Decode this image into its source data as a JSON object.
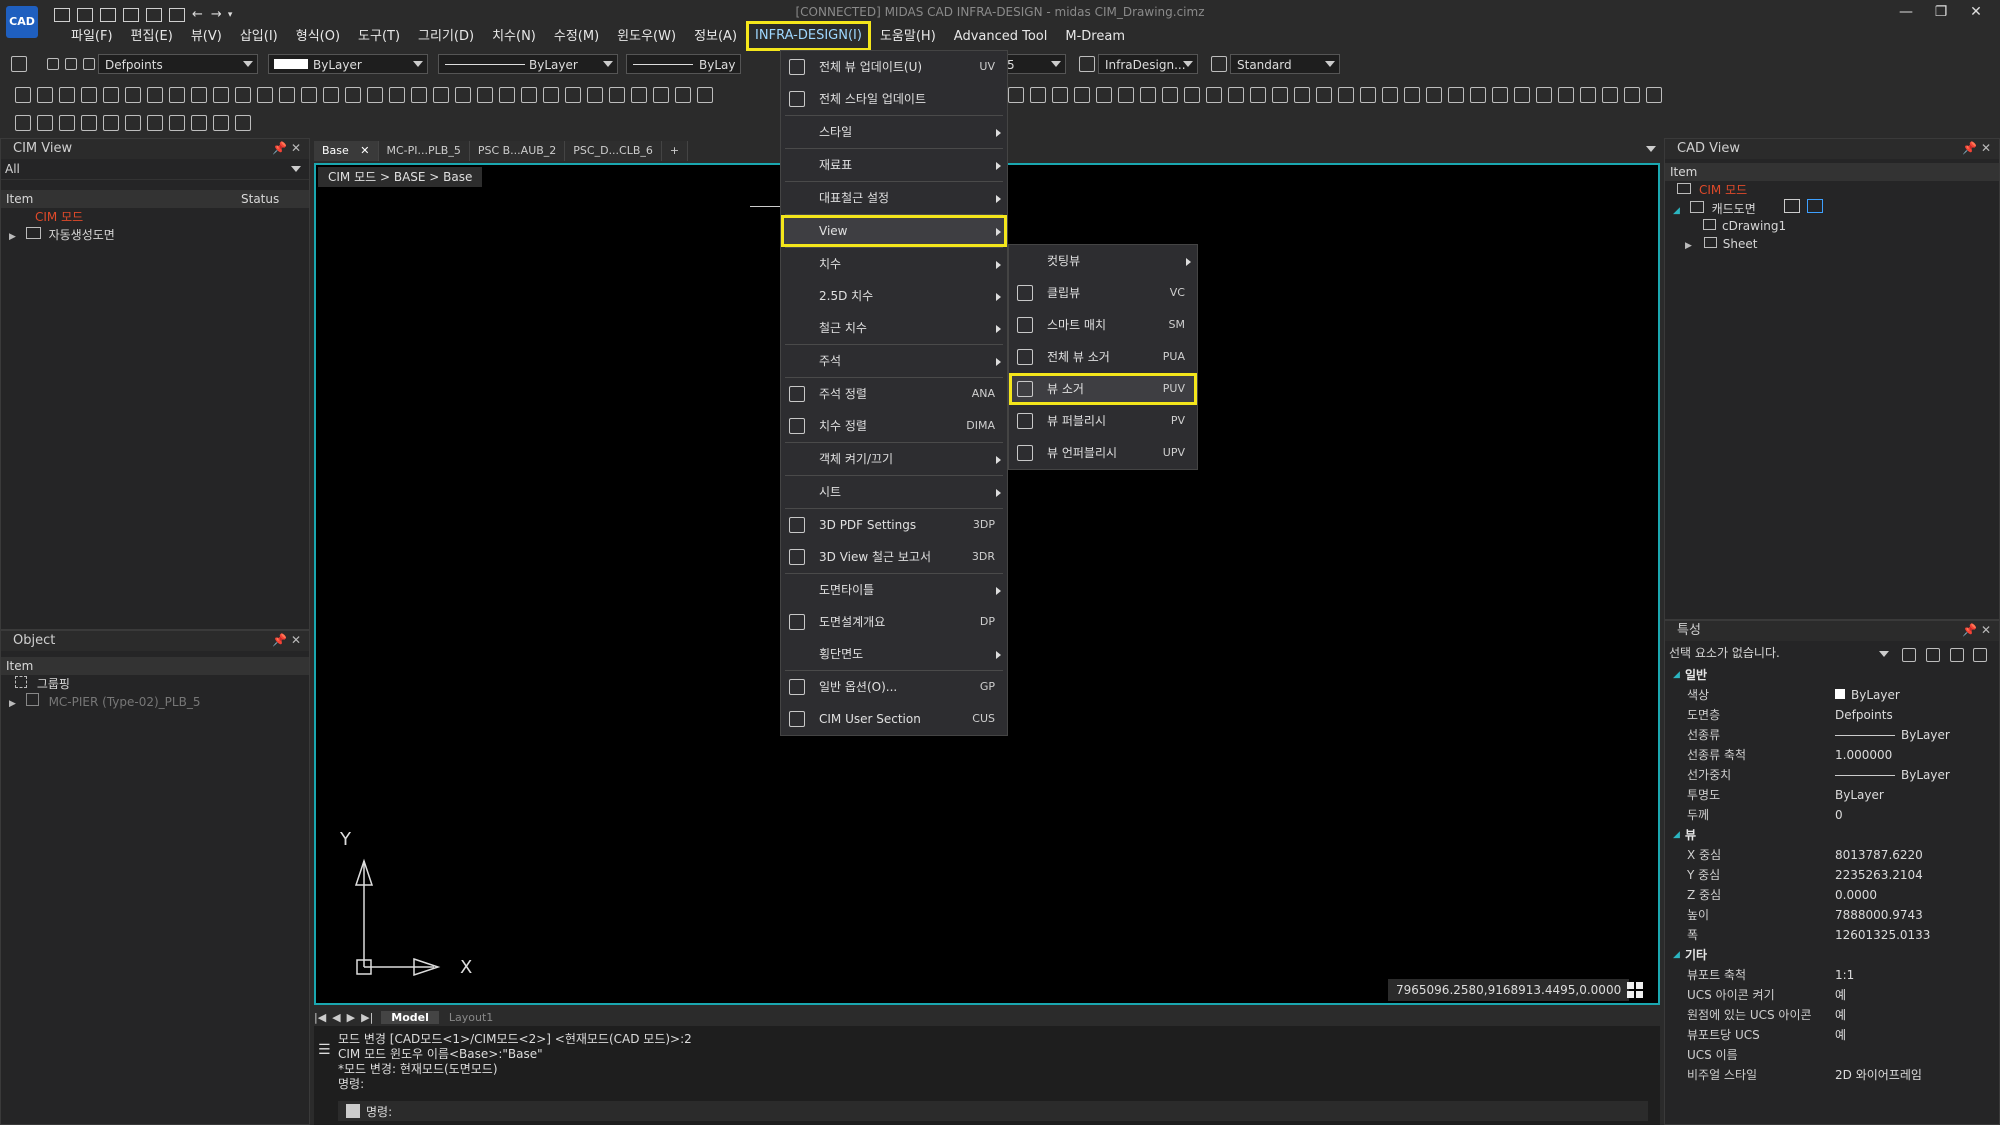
{
  "window": {
    "title": "[CONNECTED] MIDAS CAD INFRA-DESIGN - midas CIM_Drawing.cimz",
    "logo": "CAD",
    "controls": [
      "—",
      "❐",
      "✕"
    ]
  },
  "menubar": [
    "파일(F)",
    "편집(E)",
    "뷰(V)",
    "삽입(I)",
    "형식(O)",
    "도구(T)",
    "그리기(D)",
    "치수(N)",
    "수정(M)",
    "윈도우(W)",
    "정보(A)",
    "INFRA-DESIGN(I)",
    "도움말(H)",
    "Advanced Tool",
    "M-Dream"
  ],
  "toolbar": {
    "layer": "Defpoints",
    "color": "ByLayer",
    "linetype": "ByLayer",
    "lineweight": "ByLay",
    "dimstyle": "InfraDesign...",
    "textstyle": "Standard",
    "num": "5"
  },
  "cim_view": {
    "title": "CIM View",
    "filter": "All",
    "col_item": "Item",
    "col_status": "Status",
    "root": "CIM 모드",
    "child": "자동생성도면"
  },
  "object_panel": {
    "title": "Object",
    "col_item": "Item",
    "row1": "그룹핑",
    "row2": "MC-PIER (Type-02)_PLB_5"
  },
  "doc_tabs": [
    "Base",
    "MC-PI...PLB_5",
    "PSC B...AUB_2",
    "PSC_D...CLB_6",
    "+"
  ],
  "breadcrumb": "CIM 모드 > BASE > Base",
  "canvas": {
    "axis_y": "Y",
    "axis_x": "X",
    "coords": "7965096.2580,9168913.4495,0.0000"
  },
  "layout_tabs": [
    "Model",
    "Layout1"
  ],
  "command": {
    "lines": [
      "모드 변경 [CAD모드<1>/CIM모드<2>] <현재모드(CAD 모드)>:2",
      "CIM 모드 윈도우 이름<Base>:\"Base\"",
      "*모드 변경: 현재모드(도면모드)",
      "명령:"
    ],
    "prompt": "명령:"
  },
  "infra_menu": [
    {
      "label": "전체 뷰 업데이트(U)",
      "shortcut": "UV",
      "icon": "update-view-icon"
    },
    {
      "label": "전체 스타일 업데이트",
      "shortcut": "",
      "icon": "update-style-icon"
    },
    {
      "sep": true
    },
    {
      "label": "스타일",
      "submenu": true
    },
    {
      "sep": true
    },
    {
      "label": "재료표",
      "submenu": true
    },
    {
      "sep": true
    },
    {
      "label": "대표철근 설정",
      "submenu": true
    },
    {
      "sep": true
    },
    {
      "label": "View",
      "submenu": true,
      "highlight": true
    },
    {
      "sep": true
    },
    {
      "label": "치수",
      "submenu": true
    },
    {
      "label": "2.5D 치수",
      "submenu": true
    },
    {
      "label": "철근 치수",
      "submenu": true
    },
    {
      "sep": true
    },
    {
      "label": "주석",
      "submenu": true
    },
    {
      "sep": true
    },
    {
      "label": "주석 정렬",
      "shortcut": "ANA",
      "icon": "annotation-align-icon"
    },
    {
      "label": "치수 정렬",
      "shortcut": "DIMA",
      "icon": "dimension-align-icon"
    },
    {
      "sep": true
    },
    {
      "label": "객체 켜기/끄기",
      "submenu": true
    },
    {
      "sep": true
    },
    {
      "label": "시트",
      "submenu": true
    },
    {
      "sep": true
    },
    {
      "label": "3D PDF Settings",
      "shortcut": "3DP",
      "icon": "pdf-3d-icon"
    },
    {
      "label": "3D View 철근 보고서",
      "shortcut": "3DR",
      "icon": "rebar-report-icon"
    },
    {
      "sep": true
    },
    {
      "label": "도면타이틀",
      "submenu": true
    },
    {
      "label": "도면설계개요",
      "shortcut": "DP",
      "icon": "design-overview-icon"
    },
    {
      "label": "횡단면도",
      "submenu": true
    },
    {
      "sep": true
    },
    {
      "label": "일반 옵션(O)...",
      "shortcut": "GP",
      "icon": "gear-icon"
    },
    {
      "label": "CIM User Section",
      "shortcut": "CUS",
      "icon": "user-section-icon"
    }
  ],
  "view_submenu": [
    {
      "label": "컷팅뷰",
      "submenu": true
    },
    {
      "label": "클립뷰",
      "shortcut": "VC",
      "icon": "clip-view-icon"
    },
    {
      "label": "스마트 매치",
      "shortcut": "SM",
      "icon": "smart-match-icon"
    },
    {
      "label": "전체 뷰 소거",
      "shortcut": "PUA",
      "icon": "purge-all-icon"
    },
    {
      "label": "뷰 소거",
      "shortcut": "PUV",
      "icon": "purge-view-icon",
      "highlight": true
    },
    {
      "label": "뷰 퍼블리시",
      "shortcut": "PV",
      "icon": "publish-view-icon"
    },
    {
      "label": "뷰 언퍼블리시",
      "shortcut": "UPV",
      "icon": "unpublish-view-icon"
    }
  ],
  "cad_view": {
    "title": "CAD View",
    "col_item": "Item",
    "root": "CIM 모드",
    "child": "캐드도면",
    "sub1": "cDrawing1",
    "sub2": "Sheet"
  },
  "properties": {
    "title": "특성",
    "selection": "선택 요소가 없습니다.",
    "sections": [
      {
        "name": "일반",
        "rows": [
          {
            "k": "색상",
            "v": "ByLayer",
            "swatch": "#ffffff"
          },
          {
            "k": "도면층",
            "v": "Defpoints"
          },
          {
            "k": "선종류",
            "v": "ByLayer",
            "line": true
          },
          {
            "k": "선종류 축척",
            "v": "1.000000"
          },
          {
            "k": "선가중치",
            "v": "ByLayer",
            "line": true
          },
          {
            "k": "투명도",
            "v": "ByLayer"
          },
          {
            "k": "두께",
            "v": "0"
          }
        ]
      },
      {
        "name": "뷰",
        "rows": [
          {
            "k": "X 중심",
            "v": "8013787.6220",
            "dim": true
          },
          {
            "k": "Y 중심",
            "v": "2235263.2104",
            "dim": true
          },
          {
            "k": "Z 중심",
            "v": "0.0000",
            "dim": true
          },
          {
            "k": "높이",
            "v": "7888000.9743",
            "dim": true
          },
          {
            "k": "폭",
            "v": "12601325.0133",
            "dim": true
          }
        ]
      },
      {
        "name": "기타",
        "rows": [
          {
            "k": "뷰포트 축척",
            "v": "1:1"
          },
          {
            "k": "UCS 아이콘 켜기",
            "v": "예"
          },
          {
            "k": "원점에 있는 UCS 아이콘",
            "v": "예"
          },
          {
            "k": "뷰포트당 UCS",
            "v": "예",
            "dim": true
          },
          {
            "k": "UCS 이름",
            "v": ""
          },
          {
            "k": "비주얼 스타일",
            "v": "2D 와이어프레임",
            "dim": true
          }
        ]
      }
    ]
  }
}
